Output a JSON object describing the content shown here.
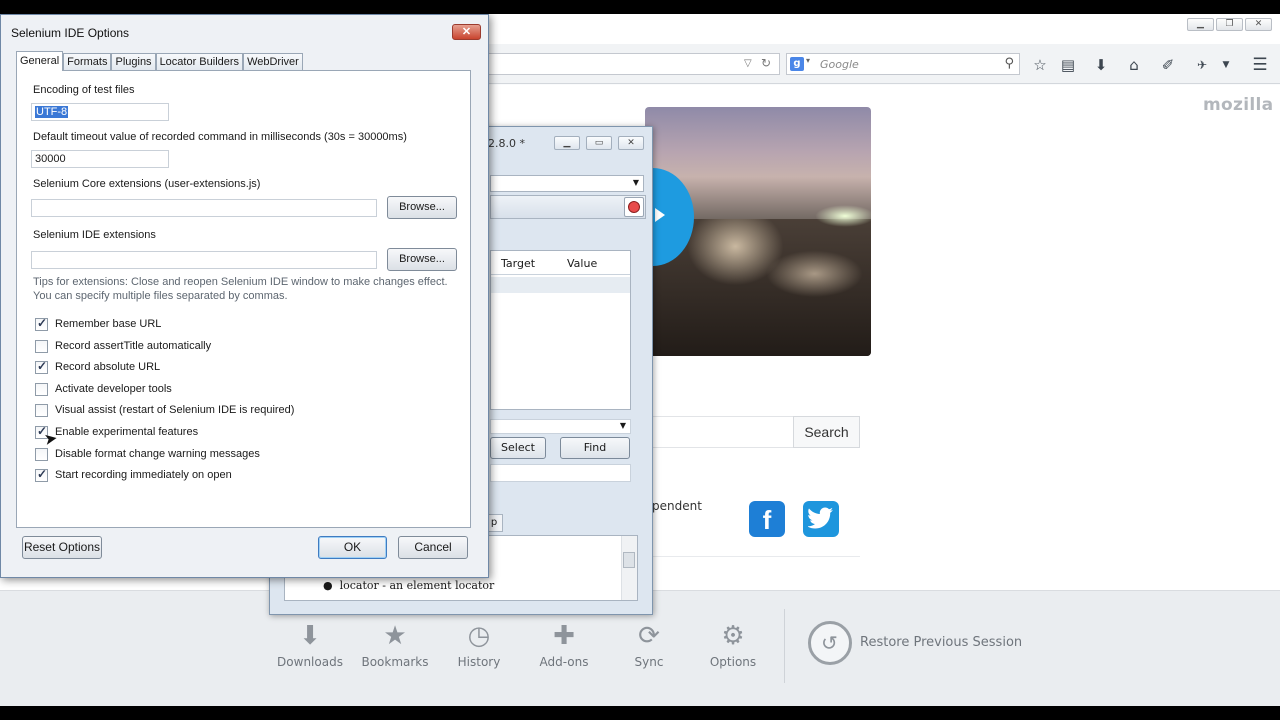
{
  "firefox": {
    "search_placeholder": "Google",
    "brand": "mozilla",
    "search_button": "Search",
    "snippet_text": "pendent",
    "facebook_glyph": "f",
    "launcher": [
      {
        "label": "Downloads",
        "icon": "download-icon"
      },
      {
        "label": "Bookmarks",
        "icon": "star-icon"
      },
      {
        "label": "History",
        "icon": "clock-icon"
      },
      {
        "label": "Add-ons",
        "icon": "puzzle-icon"
      },
      {
        "label": "Sync",
        "icon": "sync-icon"
      },
      {
        "label": "Options",
        "icon": "gear-icon"
      }
    ],
    "restore_session": "Restore Previous Session",
    "accent_color": "#1e9be0"
  },
  "ide": {
    "title_fragment": "2.8.0 *",
    "columns": [
      "Target",
      "Value"
    ],
    "select_button": "Select",
    "find_button": "Find",
    "tab_fragment": "p",
    "reference_item": "locator - an element locator"
  },
  "dialog": {
    "title": "Selenium IDE Options",
    "tabs": [
      "General",
      "Formats",
      "Plugins",
      "Locator Builders",
      "WebDriver"
    ],
    "encoding_label": "Encoding of test files",
    "encoding_value": "UTF-8",
    "timeout_label": "Default timeout value of recorded command in milliseconds (30s = 30000ms)",
    "timeout_value": "30000",
    "core_ext_label": "Selenium Core extensions (user-extensions.js)",
    "ide_ext_label": "Selenium IDE extensions",
    "browse_label": "Browse...",
    "tip_line1": "Tips for extensions: Close and reopen Selenium IDE window to make changes effect.",
    "tip_line2": "You can specify multiple files separated by commas.",
    "options": [
      {
        "label": "Remember base URL",
        "checked": true
      },
      {
        "label": "Record assertTitle automatically",
        "checked": false
      },
      {
        "label": "Record absolute URL",
        "checked": true
      },
      {
        "label": "Activate developer tools",
        "checked": false
      },
      {
        "label": "Visual assist (restart of Selenium IDE is required)",
        "checked": false
      },
      {
        "label": "Enable experimental features",
        "checked": true
      },
      {
        "label": "Disable format change warning messages",
        "checked": false
      },
      {
        "label": "Start recording immediately on open",
        "checked": true
      }
    ],
    "reset_button": "Reset Options",
    "ok_button": "OK",
    "cancel_button": "Cancel"
  }
}
